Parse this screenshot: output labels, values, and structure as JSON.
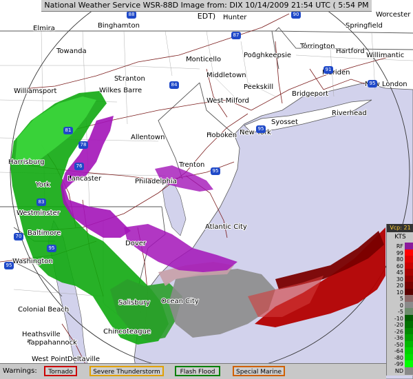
{
  "title": "National Weather Service WSR-88D Image from: DIX 10/14/2009 21:54 UTC ( 5:54 PM EDT)",
  "cities": [
    {
      "id": "elmira",
      "name": "Elmira"
    },
    {
      "id": "binghamton",
      "name": "Binghamton"
    },
    {
      "id": "hunter",
      "name": "Hunter"
    },
    {
      "id": "worcester",
      "name": "Worcester"
    },
    {
      "id": "springfield",
      "name": "Springfield"
    },
    {
      "id": "towanda",
      "name": "Towanda"
    },
    {
      "id": "monticello",
      "name": "Monticello"
    },
    {
      "id": "poughkeepsie",
      "name": "Poughkeepsie"
    },
    {
      "id": "torrington",
      "name": "Torrington"
    },
    {
      "id": "hartford",
      "name": "Hartford"
    },
    {
      "id": "willimantic",
      "name": "Willimantic"
    },
    {
      "id": "middletown",
      "name": "Middletown"
    },
    {
      "id": "meriden",
      "name": "Meriden"
    },
    {
      "id": "williamsport",
      "name": "Williamsport"
    },
    {
      "id": "scranton",
      "name": "Scranton"
    },
    {
      "id": "wilkes-barre",
      "name": "Wilkes Barre"
    },
    {
      "id": "peekskill",
      "name": "Peekskill"
    },
    {
      "id": "new-london",
      "name": "New London"
    },
    {
      "id": "bridgeport",
      "name": "Bridgeport"
    },
    {
      "id": "west-milford",
      "name": "West Milford"
    },
    {
      "id": "riverhead",
      "name": "Riverhead"
    },
    {
      "id": "syosset",
      "name": "Syosset"
    },
    {
      "id": "hoboken",
      "name": "Hoboken"
    },
    {
      "id": "new-york",
      "name": "New York"
    },
    {
      "id": "allentown",
      "name": "Allentown"
    },
    {
      "id": "harrisburg",
      "name": "Harrisburg"
    },
    {
      "id": "trenton",
      "name": "Trenton"
    },
    {
      "id": "lancaster",
      "name": "Lancaster"
    },
    {
      "id": "york",
      "name": "York"
    },
    {
      "id": "philadelphia",
      "name": "Philadelphia"
    },
    {
      "id": "westminster",
      "name": "Westminster"
    },
    {
      "id": "baltimore",
      "name": "Baltimore"
    },
    {
      "id": "atlantic-city",
      "name": "Atlantic City"
    },
    {
      "id": "dover",
      "name": "Dover"
    },
    {
      "id": "washington",
      "name": "Washington"
    },
    {
      "id": "salisbury",
      "name": "Salisbury"
    },
    {
      "id": "ocean-city",
      "name": "Ocean City"
    },
    {
      "id": "colonial-beach",
      "name": "Colonial Beach"
    },
    {
      "id": "chincoteague",
      "name": "Chincoteague"
    },
    {
      "id": "heathsville",
      "name": "Heathsville"
    },
    {
      "id": "tappahannock",
      "name": "Tappahannock"
    },
    {
      "id": "west-point",
      "name": "West Point"
    },
    {
      "id": "deltaville",
      "name": "Deltaville"
    }
  ],
  "highways": [
    "88",
    "90",
    "87",
    "84",
    "91",
    "95",
    "81",
    "78",
    "76",
    "83",
    "70",
    "95",
    "95",
    "95",
    "95"
  ],
  "legend": {
    "vcp": "Vcp: 21",
    "unit": "KTS",
    "rows": [
      {
        "label": "RF",
        "color": "#8b1a9c"
      },
      {
        "label": "99",
        "color": "#ff0000"
      },
      {
        "label": "80",
        "color": "#e00000"
      },
      {
        "label": "60",
        "color": "#c80000"
      },
      {
        "label": "45",
        "color": "#a80000"
      },
      {
        "label": "30",
        "color": "#900000"
      },
      {
        "label": "20",
        "color": "#780000"
      },
      {
        "label": "10",
        "color": "#5c0000"
      },
      {
        "label": "5",
        "color": "#8c6a6a"
      },
      {
        "label": "0",
        "color": "#8a8a8a"
      },
      {
        "label": "-5",
        "color": "#6c8c6c"
      },
      {
        "label": "-10",
        "color": "#005c00"
      },
      {
        "label": "-20",
        "color": "#007000"
      },
      {
        "label": "-26",
        "color": "#008800"
      },
      {
        "label": "-36",
        "color": "#00a000"
      },
      {
        "label": "-50",
        "color": "#00b800"
      },
      {
        "label": "-64",
        "color": "#00d000"
      },
      {
        "label": "-80",
        "color": "#00e000"
      },
      {
        "label": "-99",
        "color": "#00ff00"
      },
      {
        "label": "ND",
        "color": "#8a8a8a"
      }
    ]
  },
  "warnings": {
    "label": "Warnings:",
    "items": [
      {
        "label": "Tornado",
        "border": "#cc0000"
      },
      {
        "label": "Severe Thunderstorm",
        "border": "#e0a000"
      },
      {
        "label": "Flash Flood",
        "border": "#008000"
      },
      {
        "label": "Special Marine",
        "border": "#d06000"
      }
    ]
  }
}
